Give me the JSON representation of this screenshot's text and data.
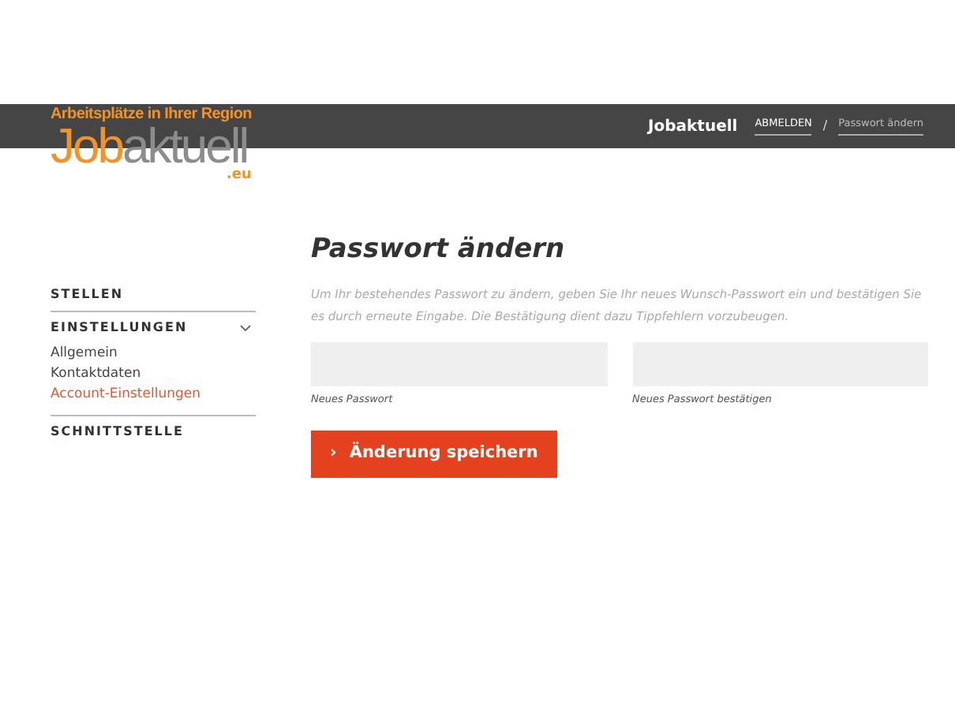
{
  "logo": {
    "tagline": "Arbeitsplätze in Ihrer Region",
    "brand_first": "Job",
    "brand_second": "aktuell",
    "domain": ".eu"
  },
  "header": {
    "site_name": "Jobaktuell",
    "breadcrumb": [
      {
        "label": "ABMELDEN",
        "kind": "action"
      },
      {
        "label": "Passwort ändern",
        "kind": "current"
      }
    ],
    "separator": "/"
  },
  "sidebar": {
    "items": [
      {
        "label": "STELLEN",
        "expanded": false
      },
      {
        "label": "EINSTELLUNGEN",
        "expanded": true,
        "children": [
          {
            "label": "Allgemein",
            "selected": false
          },
          {
            "label": "Kontaktdaten",
            "selected": false
          },
          {
            "label": "Account-Einstellungen",
            "selected": true
          }
        ]
      },
      {
        "label": "SCHNITTSTELLE",
        "expanded": false
      }
    ]
  },
  "main": {
    "title": "Passwort ändern",
    "description": "Um Ihr bestehendes Passwort zu ändern, geben Sie Ihr neues Wunsch-Passwort ein und bestätigen Sie es durch erneute Eingabe. Die Bestätigung dient dazu Tippfehlern vorzubeugen.",
    "fields": [
      {
        "label": "Neues Passwort"
      },
      {
        "label": "Neues Passwort bestätigen"
      }
    ],
    "button": {
      "icon": "›",
      "label": "Änderung speichern"
    }
  }
}
